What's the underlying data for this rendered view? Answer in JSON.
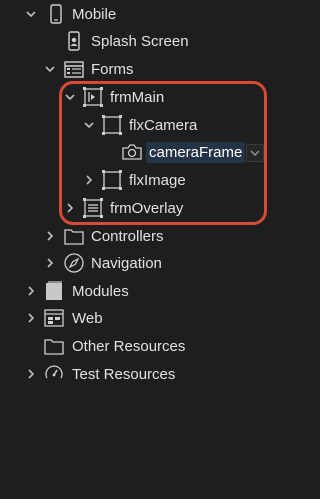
{
  "tree": {
    "mobile": "Mobile",
    "splash_screen": "Splash Screen",
    "forms": "Forms",
    "frm_main": "frmMain",
    "flx_camera": "flxCamera",
    "camera_frame": "cameraFrame",
    "flx_image": "flxImage",
    "frm_overlay": "frmOverlay",
    "controllers": "Controllers",
    "navigation": "Navigation",
    "modules": "Modules",
    "web": "Web",
    "other_resources": "Other Resources",
    "test_resources": "Test Resources"
  },
  "highlight_color": "#d64b36",
  "selection_color": "#243447"
}
